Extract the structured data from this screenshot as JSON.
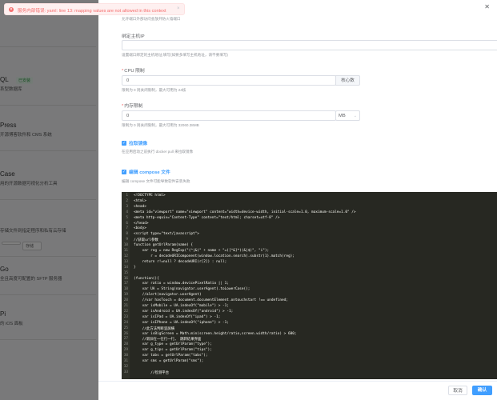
{
  "toast": {
    "message": "服务内部错误: yaml: line 13: mapping values are not allowed in this context",
    "icon": "error-circle-icon",
    "color": "#f56c6c"
  },
  "background_apps": [
    {
      "title": "",
      "desc": "",
      "badge": ""
    },
    {
      "title": "QL",
      "desc": "系型数据库",
      "badge": "已安装"
    },
    {
      "title": "Press",
      "desc": "开源博客软件和 CMS 系统",
      "badge": ""
    },
    {
      "title": "Case",
      "desc": "用的开源数据可视化分析工具",
      "badge": ""
    },
    {
      "title": "",
      "desc": "存储文件到指定程序和私有云存储",
      "badge": "",
      "chips": [
        "",
        "存储"
      ]
    },
    {
      "title": "Go",
      "desc": "全且高度可配置的 SFTP 服务器",
      "badge": ""
    },
    {
      "title": "Pi",
      "desc": "的 iOS 面板",
      "badge": ""
    }
  ],
  "drawer": {
    "top_hint": "允许端口外部访问会放开防火墙端口",
    "bind_ip": {
      "label": "绑定主机IP",
      "value": "",
      "hint": "设置端口绑定的主机地址;填写(如要多填写主机地址，请不要填写)"
    },
    "cpu": {
      "label": "CPU 限制",
      "value": "0",
      "unit": "核心数",
      "hint": "限制为 0 则关闭限制，最大可用为 24核"
    },
    "memory": {
      "label": "内存限制",
      "value": "0",
      "unit": "MB",
      "hint": "限制为 0 则关闭限制，最大可用为 32060.38MB"
    },
    "pull_image": {
      "label": "拉取镜像",
      "checked": true,
      "hint": "在应用启动之前执行 docker pull 来拉取镜像"
    },
    "edit_compose": {
      "label": "编辑 compose 文件",
      "checked": true,
      "hint": "编辑 compose 文件可能导致软件安装失败"
    },
    "code_lines": [
      "<!DOCTYPE html>",
      "<html>",
      "<head>",
      "<meta id=\"viewport\" name=\"viewport\" content=\"width=device-width, initial-scale=1.0, maximum-scale=1.0\" />",
      "<meta http-equiv=\"Content-Type\" content=\"text/html; charset=utf-8\" />",
      "</head>",
      "<body>",
      "<script type=\"text/javascript\">",
      "//获取url参数",
      "function getUrlParam(name) {",
      "    var reg = new RegExp(\"(^|&)\" + name + \"=([^&]*)(&|$)\", \"i\");",
      "        r = decodeURIComponent(window.location.search).substr(1).match(reg);",
      "    return r!=null ? decodeURI(r[2]) : null;",
      "}",
      "",
      "(function(){",
      "    var ratio = window.devicePixelRatio || 1;",
      "    var UA = String(navigator.userAgent).toLowerCase();",
      "    //alert(navigator.userAgent)",
      "    //var hasTouch = document.documentElement.ontouchstart !== undefined;",
      "    var isMobile = UA.indexOf(\"mobile\") > -1;",
      "    var isAndroid = UA.indexOf(\"android\") > -1;",
      "    var isIPad = UA.indexOf(\"ipad\") > -1;",
      "    var isIPhone = UA.indexOf(\"iphone\") > -1;",
      "    //此方法判断竖屏横",
      "    var isBigScreen = Math.min(screen.height/ratio,screen.width/ratio) > 600;",
      "    //新旧在一在行一行， 跳转结果界面",
      "    var g_type = getUrlParam(\"type\");",
      "    var g_tips = getUrlParam(\"tips\");",
      "    var tabs = getUrlParam(\"tabs\");",
      "    var sms = getUrlParam(\"sms\");",
      "",
      "        //检测平台"
    ],
    "footer": {
      "cancel_label": "取消",
      "ok_label": "确认"
    },
    "accent_color": "#409eff"
  }
}
